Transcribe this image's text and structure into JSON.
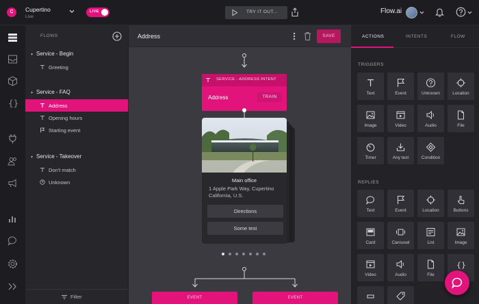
{
  "topbar": {
    "project_initial": "C",
    "project_name": "Cupertino",
    "project_status": "Live",
    "live_label": "LIVE",
    "try_label": "TRY IT OUT...",
    "brand": "Flow.ai"
  },
  "flows": {
    "title": "FLOWS",
    "groups": [
      {
        "title": "Service - Begin",
        "items": [
          {
            "icon": "text-icon",
            "label": "Greeting"
          }
        ]
      },
      {
        "title": "Service - FAQ",
        "items": [
          {
            "icon": "text-icon",
            "label": "Address"
          },
          {
            "icon": "text-icon",
            "label": "Opening hours"
          },
          {
            "icon": "flag-icon",
            "label": "Starting event"
          }
        ]
      },
      {
        "title": "Service - Takeover",
        "items": [
          {
            "icon": "text-icon",
            "label": "Don't match"
          },
          {
            "icon": "question-icon",
            "label": "Unknown"
          }
        ]
      }
    ],
    "filter_label": "Filter"
  },
  "canvas": {
    "title": "Address",
    "save_label": "SAVE",
    "intent_card": {
      "header": "SERVICE - ADDRESS INTENT",
      "name": "Address",
      "train_label": "TRAIN"
    },
    "gallery_card": {
      "title": "Main office",
      "subtitle": "1 Apple Park Way, Cupertino California, U.S.",
      "buttons": [
        "Directions",
        "Some test"
      ]
    },
    "event_left": "EVENT",
    "event_right": "EVENT"
  },
  "right_panel": {
    "tabs": [
      "ACTIONS",
      "INTENTS",
      "FLOW"
    ],
    "triggers_title": "TRIGGERS",
    "triggers": [
      {
        "icon": "text-icon",
        "label": "Text"
      },
      {
        "icon": "flag-icon",
        "label": "Event"
      },
      {
        "icon": "question-icon",
        "label": "Unknown"
      },
      {
        "icon": "crosshair-icon",
        "label": "Location"
      },
      {
        "icon": "image-icon",
        "label": "Image"
      },
      {
        "icon": "video-icon",
        "label": "Video"
      },
      {
        "icon": "speaker-icon",
        "label": "Audio"
      },
      {
        "icon": "file-icon",
        "label": "File"
      },
      {
        "icon": "timer-icon",
        "label": "Timer"
      },
      {
        "icon": "download-icon",
        "label": "Any text"
      },
      {
        "icon": "diamond-icon",
        "label": "Condition"
      }
    ],
    "replies_title": "REPLIES",
    "replies": [
      {
        "icon": "speech-bubble-icon",
        "label": "Text"
      },
      {
        "icon": "flag-icon",
        "label": "Event"
      },
      {
        "icon": "crosshair-icon",
        "label": "Location"
      },
      {
        "icon": "hand-pointer-icon",
        "label": "Buttons"
      },
      {
        "icon": "card-icon",
        "label": "Card"
      },
      {
        "icon": "carousel-icon",
        "label": "Carousel"
      },
      {
        "icon": "list-icon",
        "label": "List"
      },
      {
        "icon": "image-icon",
        "label": "Image"
      },
      {
        "icon": "video-icon",
        "label": "Video"
      },
      {
        "icon": "speaker-icon",
        "label": "Audio"
      },
      {
        "icon": "file-icon",
        "label": "File"
      },
      {
        "icon": "braces-icon",
        "label": ""
      }
    ]
  },
  "colors": {
    "accent": "#e2137a",
    "panel": "#222227",
    "canvas": "#3a3a40"
  }
}
